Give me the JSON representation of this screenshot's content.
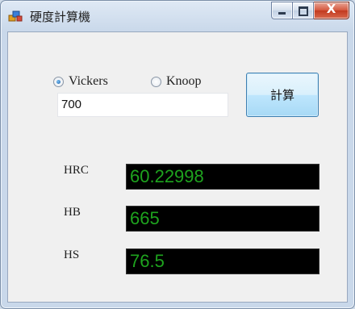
{
  "window": {
    "title": "硬度計算機",
    "close_glyph": "X"
  },
  "form": {
    "radio_vickers_label": "Vickers",
    "radio_knoop_label": "Knoop",
    "selected_method": "Vickers",
    "input_value": "700",
    "calc_button_label": "計算"
  },
  "results": {
    "hrc_label": "HRC",
    "hrc_value": "60.22998",
    "hb_label": "HB",
    "hb_value": "665",
    "hs_label": "HS",
    "hs_value": "76.5"
  },
  "colors": {
    "display_text": "#1ea31e",
    "display_background": "#000000"
  }
}
